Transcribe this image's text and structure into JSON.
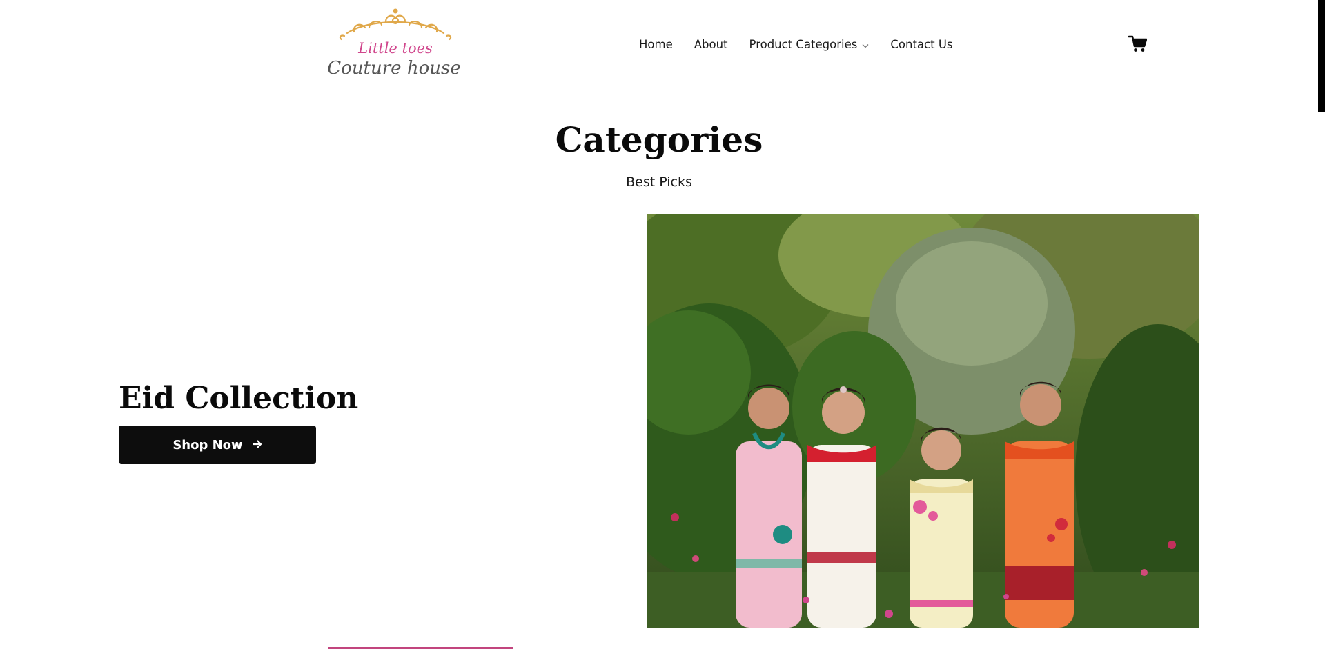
{
  "brand": {
    "logo_line1": "Little toes",
    "logo_line2": "Couture house",
    "logo_colors": {
      "crown": "#e0a84a",
      "line1": "#d0468c",
      "line2": "#555555"
    }
  },
  "nav": {
    "items": [
      {
        "label": "Home"
      },
      {
        "label": "About"
      },
      {
        "label": "Product Categories",
        "icon": "chevron-down-icon"
      },
      {
        "label": "Contact Us"
      }
    ],
    "cart_icon": "cart-icon"
  },
  "section": {
    "title": "Categories",
    "subtitle": "Best Picks"
  },
  "promo": {
    "title": "Eid Collection",
    "button_label": "Shop Now",
    "button_icon": "arrow-right-icon",
    "button_color": "#0d0d0d"
  },
  "hero_image": {
    "subject": "four-girls-garden-photo"
  }
}
